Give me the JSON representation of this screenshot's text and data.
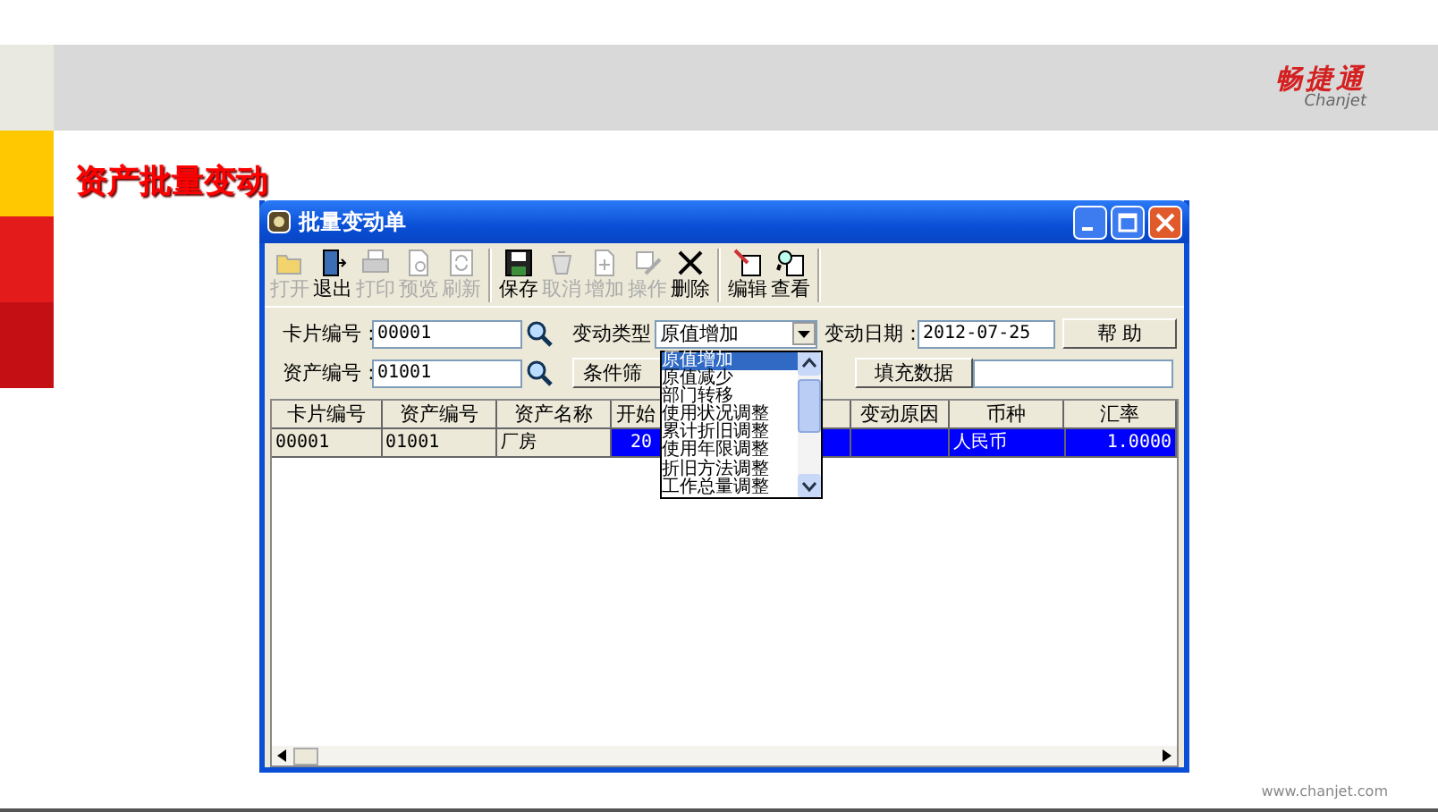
{
  "slide": {
    "title": "资产批量变动",
    "logo": {
      "name": "畅捷通",
      "latin": "Chanjet"
    },
    "footer": "www.chanjet.com"
  },
  "window": {
    "title": "批量变动单",
    "toolbar": [
      [
        {
          "label": "打开",
          "disabled": true
        },
        {
          "label": "退出",
          "disabled": false
        },
        {
          "label": "打印",
          "disabled": true
        },
        {
          "label": "预览",
          "disabled": true
        },
        {
          "label": "刷新",
          "disabled": true
        }
      ],
      [
        {
          "label": "保存",
          "disabled": false
        },
        {
          "label": "取消",
          "disabled": true
        },
        {
          "label": "增加",
          "disabled": true
        },
        {
          "label": "操作",
          "disabled": true
        },
        {
          "label": "删除",
          "disabled": false
        }
      ],
      [
        {
          "label": "编辑",
          "disabled": false
        },
        {
          "label": "查看",
          "disabled": false
        }
      ]
    ],
    "form": {
      "card_no_label": "卡片编号：",
      "card_no": "00001",
      "change_type_label": "变动类型",
      "change_type": "原值增加",
      "change_date_label": "变动日期：",
      "change_date": "2012-07-25",
      "help_button": "帮 助",
      "asset_no_label": "资产编号：",
      "asset_no": "01001",
      "filter_button": "条件筛",
      "fill_button": "填充数据"
    },
    "dropdown": [
      {
        "label": "原值增加",
        "selected": true
      },
      {
        "label": "原值减少",
        "selected": false
      },
      {
        "label": "部门转移",
        "selected": false
      },
      {
        "label": "使用状况调整",
        "selected": false
      },
      {
        "label": "累计折旧调整",
        "selected": false
      },
      {
        "label": "使用年限调整",
        "selected": false
      },
      {
        "label": "折旧方法调整",
        "selected": false
      },
      {
        "label": "工作总量调整",
        "selected": false
      }
    ],
    "table": {
      "columns": {
        "card_no": "卡片编号",
        "asset_no": "资产编号",
        "asset_name": "资产名称",
        "start": "开始",
        "reason": "变动原因",
        "currency": "币种",
        "rate": "汇率"
      },
      "rows": [
        {
          "selected": true,
          "card_no": "00001",
          "asset_no": "01001",
          "asset_name": "厂房",
          "start": "20",
          "currency": "人民币",
          "rate": "1.0000"
        }
      ]
    }
  }
}
